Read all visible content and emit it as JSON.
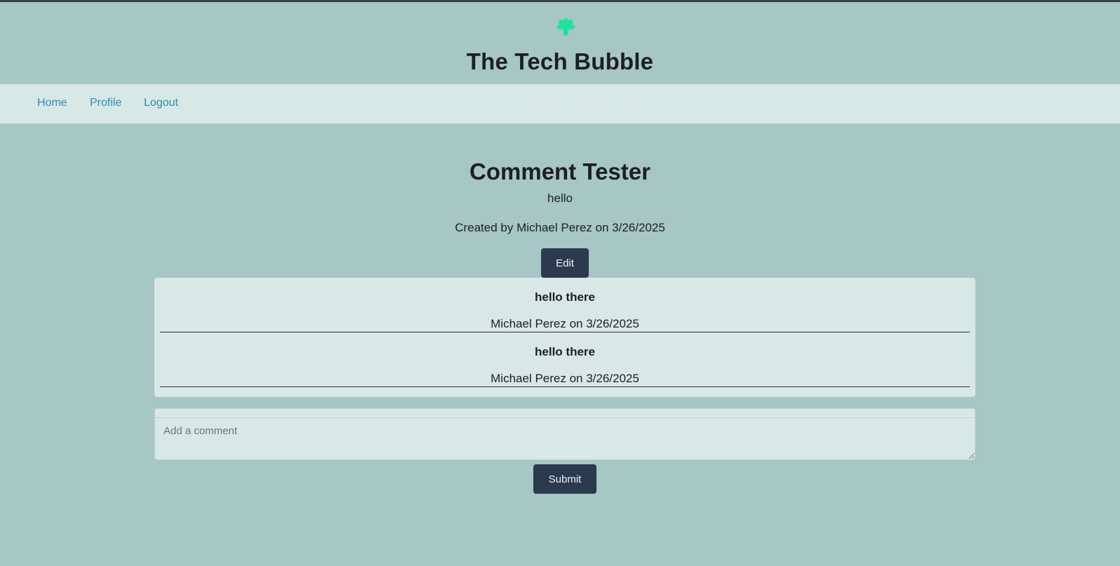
{
  "header": {
    "logo_icon": "puzzle-piece-icon",
    "logo_color": "#1fe39a",
    "title": "The Tech Bubble"
  },
  "nav": {
    "items": [
      {
        "label": "Home"
      },
      {
        "label": "Profile"
      },
      {
        "label": "Logout"
      }
    ]
  },
  "post": {
    "title": "Comment Tester",
    "body": "hello",
    "meta": "Created by Michael Perez on 3/26/2025",
    "edit_label": "Edit"
  },
  "comments": [
    {
      "text": "hello there",
      "meta": "Michael Perez on 3/26/2025"
    },
    {
      "text": "hello there",
      "meta": "Michael Perez on 3/26/2025"
    }
  ],
  "comment_form": {
    "placeholder": "Add a comment",
    "submit_label": "Submit"
  },
  "colors": {
    "background": "#a7c6c6",
    "panel": "#d8e8e7",
    "button": "#2c3a4f",
    "link": "#2f8bb5"
  }
}
